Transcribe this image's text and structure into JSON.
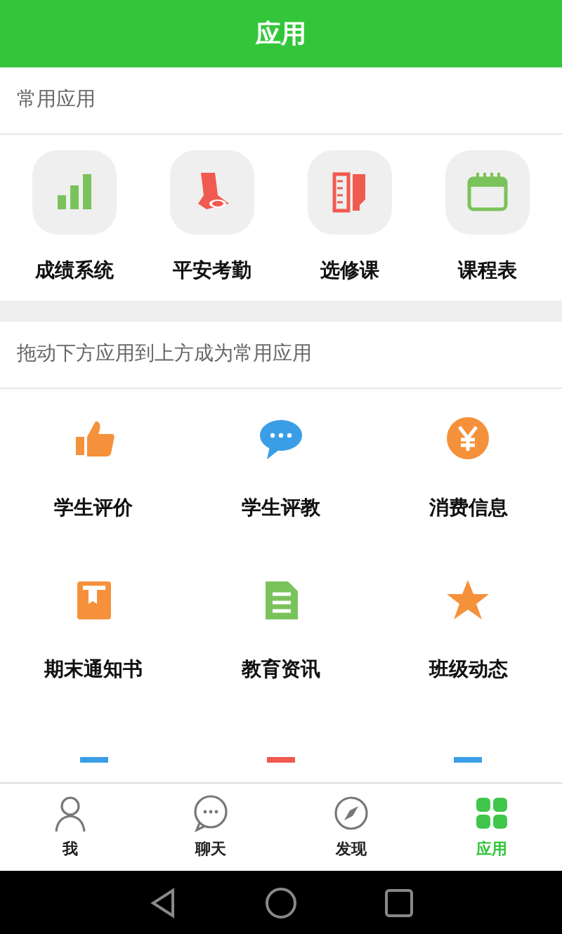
{
  "header": {
    "title": "应用"
  },
  "common_section": {
    "label": "常用应用",
    "apps": [
      {
        "label": "成绩系统"
      },
      {
        "label": "平安考勤"
      },
      {
        "label": "选修课"
      },
      {
        "label": "课程表"
      }
    ]
  },
  "all_section": {
    "hint": "拖动下方应用到上方成为常用应用",
    "apps": [
      {
        "label": "学生评价"
      },
      {
        "label": "学生评教"
      },
      {
        "label": "消费信息"
      },
      {
        "label": "期末通知书"
      },
      {
        "label": "教育资讯"
      },
      {
        "label": "班级动态"
      }
    ]
  },
  "tab_bar": [
    {
      "label": "我",
      "selected": false
    },
    {
      "label": "聊天",
      "selected": false
    },
    {
      "label": "发现",
      "selected": false
    },
    {
      "label": "应用",
      "selected": true
    }
  ]
}
